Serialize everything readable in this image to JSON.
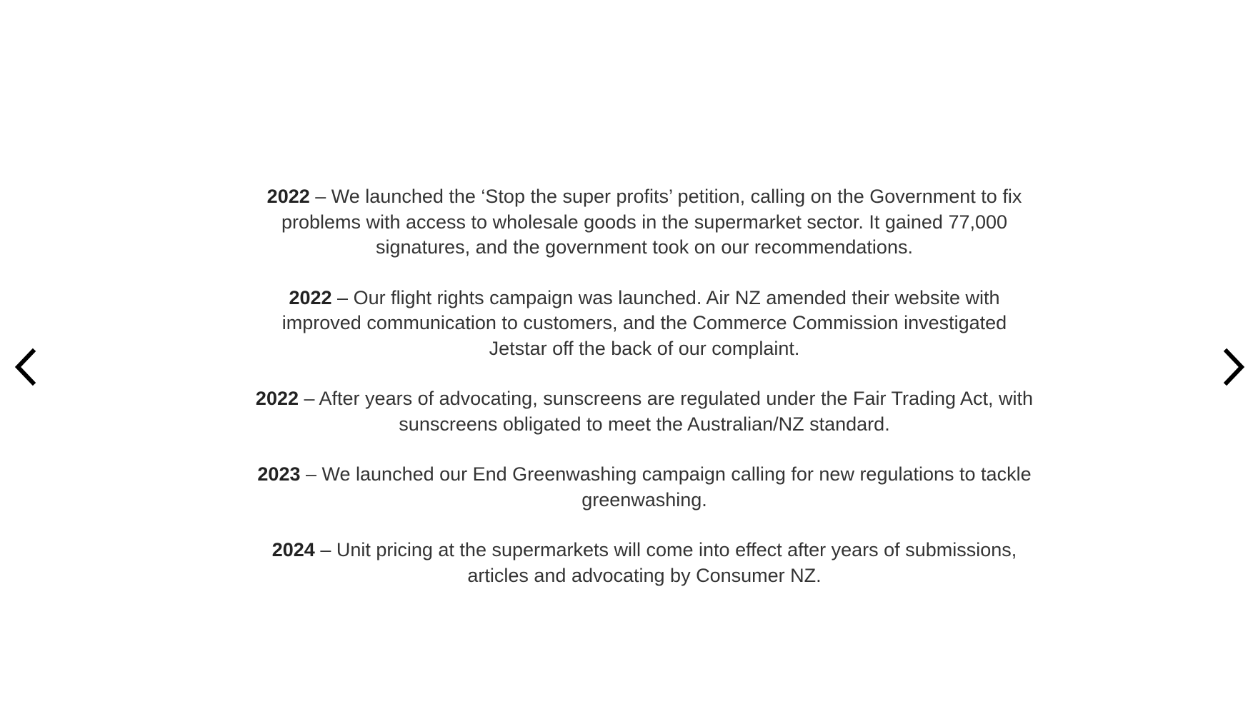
{
  "carousel": {
    "entries": [
      {
        "year": "2022",
        "text": " – We launched the ‘Stop the super profits’ petition, calling on the Government to fix problems with access to wholesale goods in the supermarket sector. It gained 77,000 signatures, and the government took on our recommendations."
      },
      {
        "year": "2022",
        "text": " – Our flight rights campaign was launched. Air NZ amended their website with improved communication to customers, and the Commerce Commission investigated Jetstar off the back of our complaint."
      },
      {
        "year": "2022",
        "text": " – After years of advocating, sunscreens are regulated under the Fair Trading Act, with sunscreens obligated to meet the Australian/NZ standard."
      },
      {
        "year": "2023",
        "text": " – We launched our End Greenwashing campaign calling for new regulations to tackle greenwashing."
      },
      {
        "year": "2024",
        "text": " – Unit pricing at the supermarkets will come into effect after years of submissions, articles and advocating by Consumer NZ."
      }
    ],
    "prev_icon": "chevron-left-icon",
    "next_icon": "chevron-right-icon"
  }
}
